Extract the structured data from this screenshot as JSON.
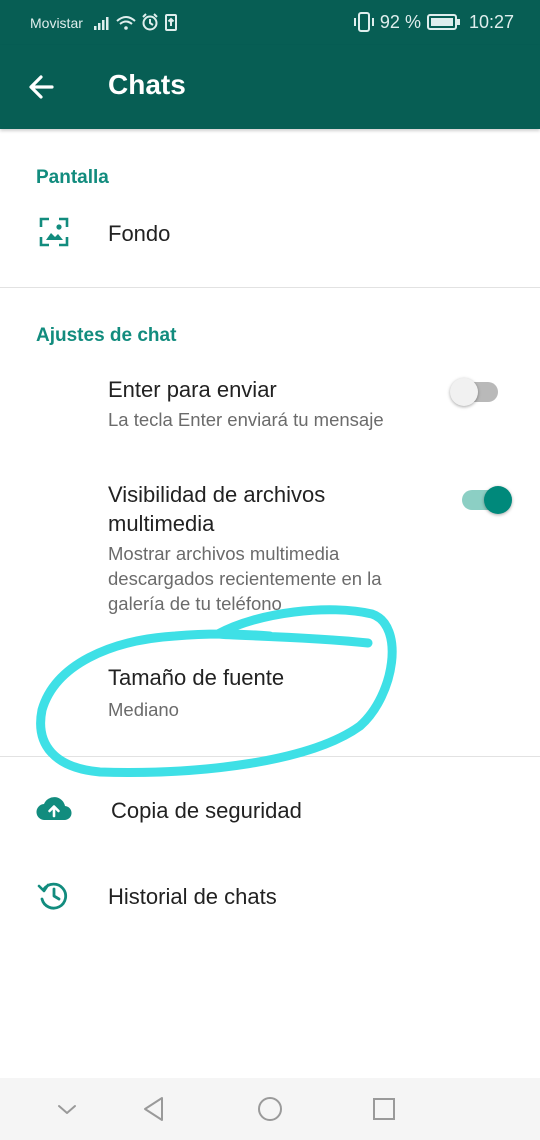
{
  "status_bar": {
    "carrier": "Movistar",
    "battery_percent": "92 %",
    "time": "10:27"
  },
  "app_bar": {
    "title": "Chats"
  },
  "sections": {
    "display": {
      "header": "Pantalla",
      "wallpaper_label": "Fondo"
    },
    "chat_settings": {
      "header": "Ajustes de chat",
      "enter_to_send": {
        "title": "Enter para enviar",
        "subtitle": "La tecla Enter enviará tu mensaje",
        "enabled": false
      },
      "media_visibility": {
        "title_line1": "Visibilidad de archivos",
        "title_line2": "multimedia",
        "subtitle_line1": "Mostrar archivos multimedia",
        "subtitle_line2": "descargados recientemente en la",
        "subtitle_line3": "galería de tu teléfono",
        "enabled": true
      },
      "font_size": {
        "title": "Tamaño de fuente",
        "value": "Mediano"
      }
    },
    "other": {
      "backup_label": "Copia de seguridad",
      "history_label": "Historial de chats"
    }
  },
  "colors": {
    "app_bar": "#075e54",
    "accent": "#128c7e",
    "toggle_on": "#00897b",
    "annotation": "#3ee0e6"
  },
  "icons": {
    "back": "arrow-left-icon",
    "wallpaper": "wallpaper-icon",
    "backup": "cloud-upload-icon",
    "history": "history-icon"
  }
}
